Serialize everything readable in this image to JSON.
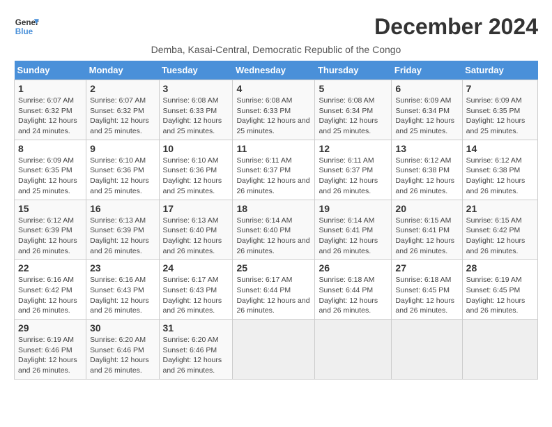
{
  "logo": {
    "line1": "General",
    "line2": "Blue"
  },
  "title": "December 2024",
  "subtitle": "Demba, Kasai-Central, Democratic Republic of the Congo",
  "weekdays": [
    "Sunday",
    "Monday",
    "Tuesday",
    "Wednesday",
    "Thursday",
    "Friday",
    "Saturday"
  ],
  "weeks": [
    [
      {
        "day": "1",
        "sunrise": "6:07 AM",
        "sunset": "6:32 PM",
        "daylight": "12 hours and 24 minutes."
      },
      {
        "day": "2",
        "sunrise": "6:07 AM",
        "sunset": "6:32 PM",
        "daylight": "12 hours and 25 minutes."
      },
      {
        "day": "3",
        "sunrise": "6:08 AM",
        "sunset": "6:33 PM",
        "daylight": "12 hours and 25 minutes."
      },
      {
        "day": "4",
        "sunrise": "6:08 AM",
        "sunset": "6:33 PM",
        "daylight": "12 hours and 25 minutes."
      },
      {
        "day": "5",
        "sunrise": "6:08 AM",
        "sunset": "6:34 PM",
        "daylight": "12 hours and 25 minutes."
      },
      {
        "day": "6",
        "sunrise": "6:09 AM",
        "sunset": "6:34 PM",
        "daylight": "12 hours and 25 minutes."
      },
      {
        "day": "7",
        "sunrise": "6:09 AM",
        "sunset": "6:35 PM",
        "daylight": "12 hours and 25 minutes."
      }
    ],
    [
      {
        "day": "8",
        "sunrise": "6:09 AM",
        "sunset": "6:35 PM",
        "daylight": "12 hours and 25 minutes."
      },
      {
        "day": "9",
        "sunrise": "6:10 AM",
        "sunset": "6:36 PM",
        "daylight": "12 hours and 25 minutes."
      },
      {
        "day": "10",
        "sunrise": "6:10 AM",
        "sunset": "6:36 PM",
        "daylight": "12 hours and 25 minutes."
      },
      {
        "day": "11",
        "sunrise": "6:11 AM",
        "sunset": "6:37 PM",
        "daylight": "12 hours and 26 minutes."
      },
      {
        "day": "12",
        "sunrise": "6:11 AM",
        "sunset": "6:37 PM",
        "daylight": "12 hours and 26 minutes."
      },
      {
        "day": "13",
        "sunrise": "6:12 AM",
        "sunset": "6:38 PM",
        "daylight": "12 hours and 26 minutes."
      },
      {
        "day": "14",
        "sunrise": "6:12 AM",
        "sunset": "6:38 PM",
        "daylight": "12 hours and 26 minutes."
      }
    ],
    [
      {
        "day": "15",
        "sunrise": "6:12 AM",
        "sunset": "6:39 PM",
        "daylight": "12 hours and 26 minutes."
      },
      {
        "day": "16",
        "sunrise": "6:13 AM",
        "sunset": "6:39 PM",
        "daylight": "12 hours and 26 minutes."
      },
      {
        "day": "17",
        "sunrise": "6:13 AM",
        "sunset": "6:40 PM",
        "daylight": "12 hours and 26 minutes."
      },
      {
        "day": "18",
        "sunrise": "6:14 AM",
        "sunset": "6:40 PM",
        "daylight": "12 hours and 26 minutes."
      },
      {
        "day": "19",
        "sunrise": "6:14 AM",
        "sunset": "6:41 PM",
        "daylight": "12 hours and 26 minutes."
      },
      {
        "day": "20",
        "sunrise": "6:15 AM",
        "sunset": "6:41 PM",
        "daylight": "12 hours and 26 minutes."
      },
      {
        "day": "21",
        "sunrise": "6:15 AM",
        "sunset": "6:42 PM",
        "daylight": "12 hours and 26 minutes."
      }
    ],
    [
      {
        "day": "22",
        "sunrise": "6:16 AM",
        "sunset": "6:42 PM",
        "daylight": "12 hours and 26 minutes."
      },
      {
        "day": "23",
        "sunrise": "6:16 AM",
        "sunset": "6:43 PM",
        "daylight": "12 hours and 26 minutes."
      },
      {
        "day": "24",
        "sunrise": "6:17 AM",
        "sunset": "6:43 PM",
        "daylight": "12 hours and 26 minutes."
      },
      {
        "day": "25",
        "sunrise": "6:17 AM",
        "sunset": "6:44 PM",
        "daylight": "12 hours and 26 minutes."
      },
      {
        "day": "26",
        "sunrise": "6:18 AM",
        "sunset": "6:44 PM",
        "daylight": "12 hours and 26 minutes."
      },
      {
        "day": "27",
        "sunrise": "6:18 AM",
        "sunset": "6:45 PM",
        "daylight": "12 hours and 26 minutes."
      },
      {
        "day": "28",
        "sunrise": "6:19 AM",
        "sunset": "6:45 PM",
        "daylight": "12 hours and 26 minutes."
      }
    ],
    [
      {
        "day": "29",
        "sunrise": "6:19 AM",
        "sunset": "6:46 PM",
        "daylight": "12 hours and 26 minutes."
      },
      {
        "day": "30",
        "sunrise": "6:20 AM",
        "sunset": "6:46 PM",
        "daylight": "12 hours and 26 minutes."
      },
      {
        "day": "31",
        "sunrise": "6:20 AM",
        "sunset": "6:46 PM",
        "daylight": "12 hours and 26 minutes."
      },
      null,
      null,
      null,
      null
    ]
  ],
  "labels": {
    "sunrise": "Sunrise:",
    "sunset": "Sunset:",
    "daylight": "Daylight:"
  }
}
